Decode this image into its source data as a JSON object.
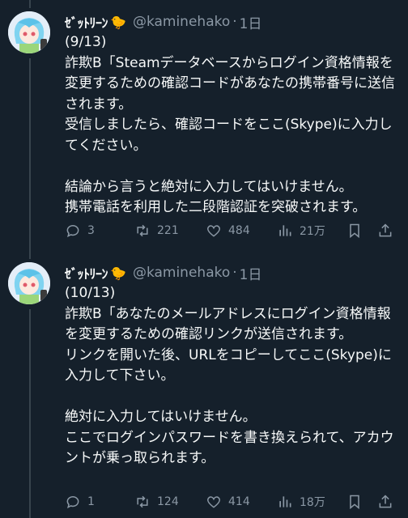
{
  "tweets": [
    {
      "name": "ｾﾞｯﾄﾘｰﾝ",
      "handle": "@kaminehako",
      "dot": "·",
      "time": "1日",
      "text": "(9/13)\n詐欺B「Steamデータベースからログイン資格情報を変更するための確認コードがあなたの携帯番号に送信されます。\n受信しましたら、確認コードをここ(Skype)に入力してください。\n\n結論から言うと絶対に入力してはいけません。\n携帯電話を利用した二段階認証を突破されます。",
      "replies": "3",
      "retweets": "221",
      "likes": "484",
      "views": "21万"
    },
    {
      "name": "ｾﾞｯﾄﾘｰﾝ",
      "handle": "@kaminehako",
      "dot": "·",
      "time": "1日",
      "text": "(10/13)\n詐欺B「あなたのメールアドレスにログイン資格情報を変更するための確認リンクが送信されます。\nリンクを開いた後、URLをコピーしてここ(Skype)に入力して下さい。\n\n絶対に入力してはいけません。\nここでログインパスワードを書き換えられて、アカウントが乗っ取られます。",
      "replies": "1",
      "retweets": "124",
      "likes": "414",
      "views": "18万"
    }
  ],
  "icons": {
    "verified_emoji": "🐤",
    "reply": "reply-icon",
    "retweet": "retweet-icon",
    "like": "heart-icon",
    "views": "views-icon",
    "bookmark": "bookmark-icon",
    "share": "share-icon"
  },
  "colors": {
    "background": "#15202b",
    "text": "#f7f9f9",
    "secondary": "#8b98a5",
    "thread_line": "#38444d"
  }
}
